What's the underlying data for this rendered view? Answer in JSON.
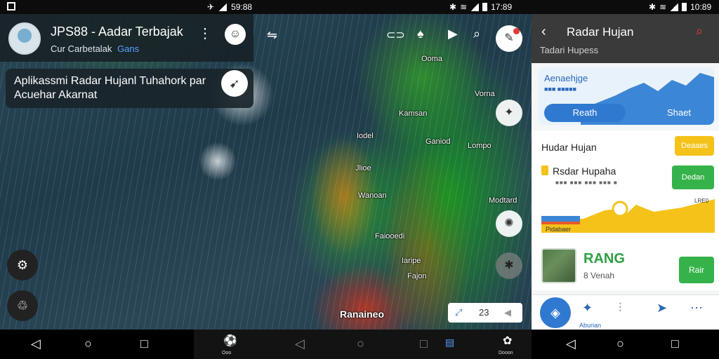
{
  "status": {
    "left_time": "59:88",
    "right_time": "17:89",
    "far_time": "10:89"
  },
  "map": {
    "app_title": "JPS88 - Aadar Terbajak",
    "app_subtitle": "Cur Carbetalak",
    "app_subtitle_badge": "Gans",
    "banner_text": "Aplikassmi Radar Hujanl Tuhahork par Acuehar Akarnat",
    "icons": {
      "avatar": "avatar-image",
      "menu": "kebab-menu-icon",
      "smile": "smile-icon",
      "banner_action": "location-arrow-icon",
      "filter": "filter-icon",
      "search": "search-icon",
      "chat": "chat-bubble-icon",
      "settings": "gear-icon",
      "recycle": "recycle-icon",
      "compass": "compass-icon"
    },
    "places": [
      {
        "name": "Ooma"
      },
      {
        "name": "Vorna"
      },
      {
        "name": "Kamsan"
      },
      {
        "name": "Iodel"
      },
      {
        "name": "Ganiod"
      },
      {
        "name": "Lompo"
      },
      {
        "name": "Jlioe"
      },
      {
        "name": "Wanoan"
      },
      {
        "name": "Modtard"
      },
      {
        "name": "Faiooedi"
      },
      {
        "name": "Iaripe"
      },
      {
        "name": "Fajon"
      },
      {
        "name": "Ranaineo"
      }
    ],
    "zoom_value": "23",
    "colors": {
      "rain_light": "#14a01e",
      "rain_heavy": "#e63c14",
      "sea": "#233f4e"
    }
  },
  "panel": {
    "title": "Radar Hujan",
    "subtitle": "Tadari Hupess",
    "card": {
      "title": "Aenaehjge",
      "subtitle": "■■■ ■■■■■",
      "toggle_left": "Reath",
      "toggle_right": "Shaet"
    },
    "rows": [
      {
        "title": "Hudar Hujan",
        "dashes": "",
        "button": "Deaaes",
        "color": "#f5c21a"
      },
      {
        "title": "Rsdar Hupaha",
        "dashes": "■■■ ■■■ ■■■ ■■■ ■",
        "button": "Dedan",
        "color": "#36b24a"
      }
    ],
    "chart_labels": {
      "left": "Pidabaer",
      "right": "LRE0"
    },
    "recommend": {
      "title": "RANG",
      "subtitle": "8 Venah",
      "button": "Rair"
    },
    "tab_label": "Aburian",
    "accent": "#2f79d0"
  },
  "navbar": {
    "mid_left_label": "Ooo",
    "mid_right_label": "Dooon"
  }
}
